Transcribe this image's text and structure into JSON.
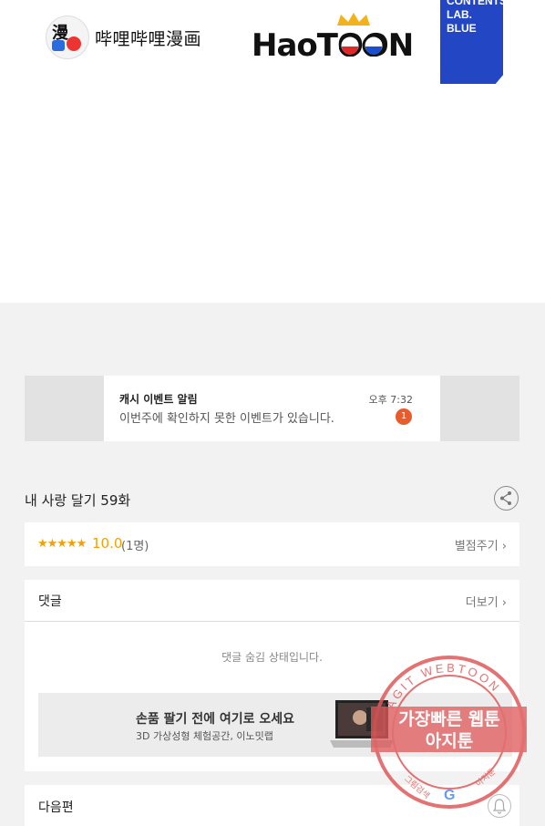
{
  "logos": {
    "bilibili_text": "哔哩哔哩漫画",
    "haotoon_text": "HaoTOON",
    "contents_lab": [
      "CONTENTS",
      "LAB.",
      "BLUE"
    ]
  },
  "notification": {
    "title": "캐시 이벤트 알림",
    "body": "이번주에 확인하지 못한 이벤트가 있습니다.",
    "time": "오후 7:32",
    "count": "1"
  },
  "episode": {
    "title": "내 사랑 달기 59화"
  },
  "rating": {
    "stars": "★★★★★",
    "score": "10.0",
    "count": "(1명)",
    "rate_link": "별점주기 ›"
  },
  "comments": {
    "title": "댓글",
    "more_link": "더보기 ›",
    "hidden_message": "댓글 숨김 상태입니다.",
    "ad_title": "손품 팔기 전에 여기로 오세요",
    "ad_subtitle": "3D 가상성형 체험공간, 이노밋랩"
  },
  "next": {
    "title": "다음편"
  },
  "watermark": {
    "arc_text": "AGIT WEBTOON",
    "line1": "가장빠른 웹툰",
    "line2": "아지툰",
    "bottom_left": "그림검색",
    "bottom_right": "아지툰"
  },
  "colors": {
    "accent_star": "#f5a000",
    "badge": "#e85b2b",
    "blue_logo": "#2346c4",
    "watermark": "#e05a5a"
  }
}
